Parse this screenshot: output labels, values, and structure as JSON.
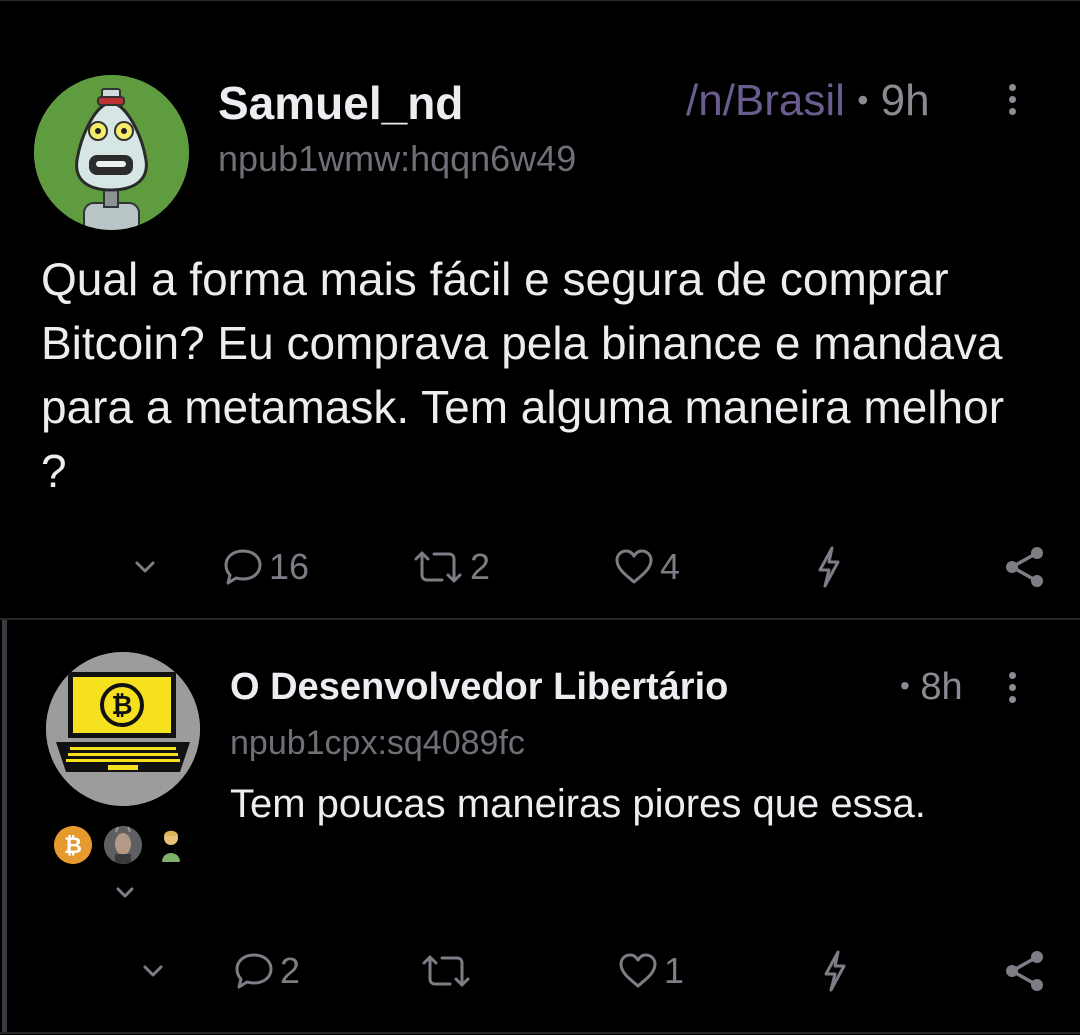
{
  "posts": [
    {
      "author": "Samuel_nd",
      "npub": "npub1wmw:hqqn6w49",
      "community": "/n/Brasil",
      "separator": "•",
      "time": "9h",
      "content": "Qual a forma mais fácil e segura de comprar Bitcoin? Eu comprava pela binance e mandava para a metamask. Tem alguma maneira melhor ?",
      "counts": {
        "replies": "16",
        "reposts": "2",
        "likes": "4"
      },
      "avatar_icon": "robot-avatar-icon"
    },
    {
      "author": "O Desenvolvedor Libertário",
      "npub": "npub1cpx:sq4089fc",
      "separator": "•",
      "time": "8h",
      "content": "Tem poucas maneiras piores que essa.",
      "counts": {
        "replies": "2",
        "likes": "1"
      },
      "avatar_icon": "bitcoin-laptop-avatar-icon",
      "repliers_icons": [
        "bitcoin-avatar-icon",
        "person-avatar-icon",
        "cartoon-avatar-icon"
      ]
    }
  ],
  "colors": {
    "background": "#000000",
    "community": "#6a5c8f",
    "muted": "#7d7d86",
    "avatar_green": "#5e9a3e",
    "bitcoin_yellow": "#f7e21a"
  }
}
